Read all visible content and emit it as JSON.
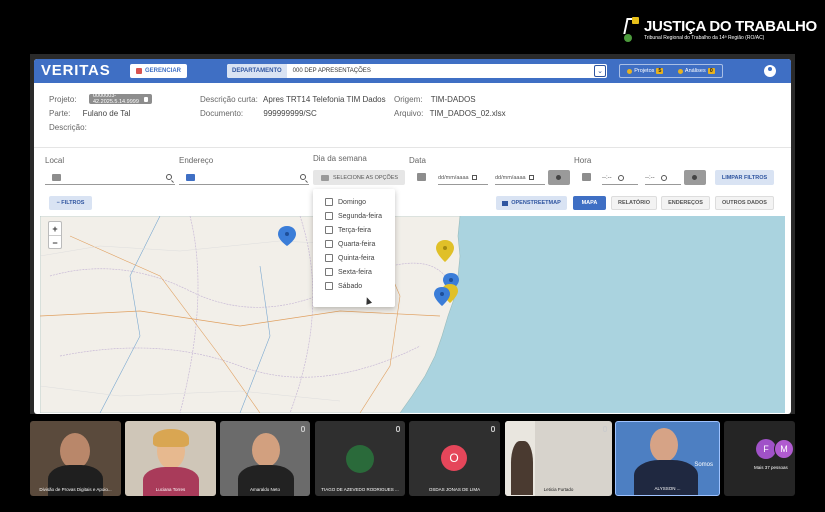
{
  "brand": {
    "title": "JUSTIÇA DO TRABALHO",
    "subtitle": "Tribunal Regional do Trabalho da 14ª Região (RO/AC)"
  },
  "app": {
    "logo": "VERITAS",
    "gerenciar_label": "GERENCIAR",
    "departamento_label": "DEPARTAMENTO",
    "departamento_value": "000 DEP APRESENTAÇÕES",
    "projetos_label": "Projetos",
    "projetos_count": "5",
    "analises_label": "Análises",
    "analises_count": "0"
  },
  "project": {
    "projeto_label": "Projeto:",
    "projeto_value": "0000003-42.2025.5.14.9999",
    "parte_label": "Parte:",
    "parte_value": "Fulano de Tal",
    "descricao_label": "Descrição:",
    "desc_curta_label": "Descrição curta:",
    "desc_curta_value": "Apres TRT14 Telefonia TIM Dados",
    "documento_label": "Documento:",
    "documento_value": "999999999/SC",
    "origem_label": "Origem:",
    "origem_value": "TIM-DADOS",
    "arquivo_label": "Arquivo:",
    "arquivo_value": "TIM_DADOS_02.xlsx"
  },
  "filters": {
    "local_label": "Local",
    "endereco_label": "Endereço",
    "dia_label": "Dia da semana",
    "data_label": "Data",
    "hora_label": "Hora",
    "selecione_label": "SELECIONE AS OPÇÕES",
    "date_placeholder": "dd/mm/aaaa",
    "hour_placeholder": "--:--",
    "limpar_label": "LIMPAR FILTROS",
    "filtros_toggle": "− FILTROS"
  },
  "tabs": {
    "openstreetmap": "OPENSTREETMAP",
    "mapa": "MAPA",
    "relatorio": "RELATÓRIO",
    "enderecos": "ENDEREÇOS",
    "outros": "OUTROS DADOS"
  },
  "weekdays": [
    "Domingo",
    "Segunda-feira",
    "Terça-feira",
    "Quarta-feira",
    "Quinta-feira",
    "Sexta-feira",
    "Sábado"
  ],
  "map": {
    "zoom_in": "+",
    "zoom_out": "−"
  },
  "participants": [
    {
      "name": "Divisão de Provas Digitais e Apoio..."
    },
    {
      "name": "Luciana Torres"
    },
    {
      "name": "Amaraldo Neto"
    },
    {
      "name": "TIAGO DE AZEVEDO RODRIGUES ..."
    },
    {
      "name": "OSDAS JONAS DE LIMA",
      "initial": "O"
    },
    {
      "name": "Leticia Furtado"
    },
    {
      "name": "ALYSSON ...",
      "badge": "Somos"
    },
    {
      "name": "Mais 37 pessoas",
      "initials": [
        "F",
        "M"
      ]
    }
  ],
  "colors": {
    "primary": "#3f6fc4",
    "sea": "#aad3df",
    "land": "#f2efe9",
    "pin_blue": "#3b7dd8",
    "pin_yellow": "#e0c028"
  }
}
